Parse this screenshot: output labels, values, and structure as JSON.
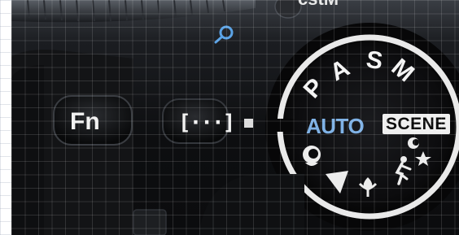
{
  "camera": {
    "buttons": {
      "fn_label": "Fn",
      "selector_label": "[···]"
    },
    "top_label": "cstM",
    "mode_dial": {
      "modes": {
        "p": "P",
        "a": "A",
        "s": "S",
        "m": "M"
      },
      "auto_label": "AUTO",
      "scene_label": "SCENE",
      "selected_mode": "AUTO",
      "icons": [
        "portrait-icon",
        "landscape-icon",
        "macro-icon",
        "sports-icon",
        "night-portrait-icon",
        "zoom-lens-icon"
      ]
    }
  },
  "colors": {
    "body": "#101114",
    "accent_blue": "#7fb2e6",
    "scene_badge": "#efefef",
    "dial_ring": "#e9e9e9"
  }
}
